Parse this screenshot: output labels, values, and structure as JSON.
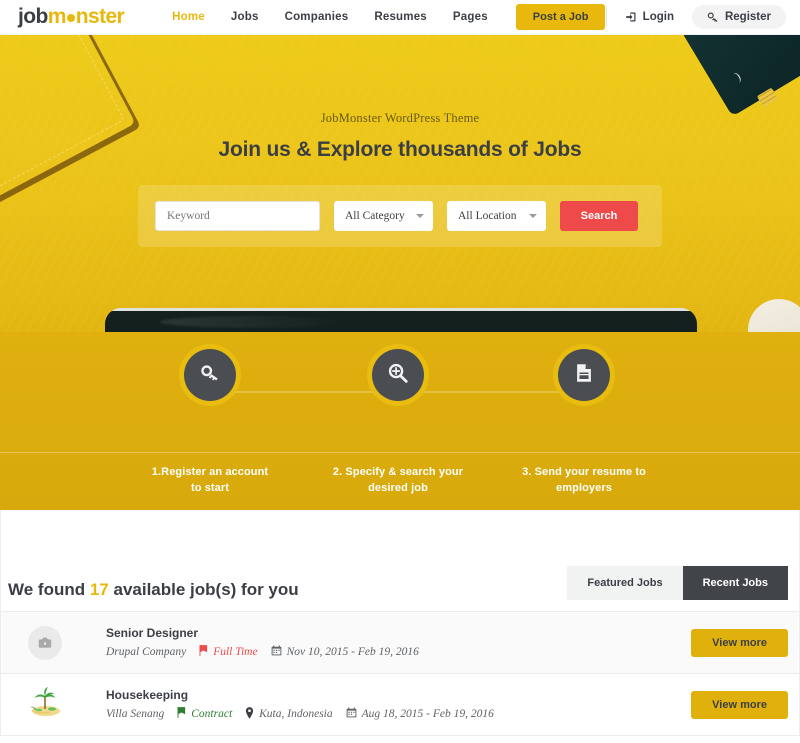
{
  "header": {
    "logo": {
      "part1": "job",
      "part2": "m",
      "part3": "nster"
    },
    "nav": [
      {
        "label": "Home",
        "active": true
      },
      {
        "label": "Jobs",
        "active": false
      },
      {
        "label": "Companies",
        "active": false
      },
      {
        "label": "Resumes",
        "active": false
      },
      {
        "label": "Pages",
        "active": false
      }
    ],
    "post_job_label": "Post a Job",
    "login_label": "Login",
    "login_icon": "sign-in-icon",
    "register_label": "Register",
    "register_icon": "key-icon"
  },
  "hero": {
    "subtitle": "JobMonster WordPress Theme",
    "title": "Join us & Explore thousands of Jobs",
    "search": {
      "keyword_placeholder": "Keyword",
      "category_value": "All Category",
      "location_value": "All Location",
      "button_label": "Search"
    },
    "colors": {
      "top": "#ecc61a",
      "bottom": "#e2b611",
      "search_button": "#ef4a4a"
    }
  },
  "steps": {
    "background": "#d8a90c",
    "items": [
      {
        "icon": "key-icon",
        "label": "1.Register an account\nto start"
      },
      {
        "icon": "search-plus-icon",
        "label": "2. Specify & search your\ndesired job"
      },
      {
        "icon": "document-icon",
        "label": "3. Send your resume to\nemployers"
      }
    ]
  },
  "jobs": {
    "heading_prefix": "We found ",
    "heading_count": "17",
    "heading_suffix": " available job(s) for you",
    "tabs": [
      {
        "label": "Featured Jobs",
        "active": false
      },
      {
        "label": "Recent Jobs",
        "active": true
      }
    ],
    "view_more_label": "View more",
    "list": [
      {
        "thumb_icon": "briefcase-icon",
        "title": "Senior Designer",
        "company": "Drupal Company",
        "type": "Full Time",
        "type_color": "#ef4a4a",
        "location": "",
        "dates": "Nov 10, 2015 - Feb 19, 2016",
        "view_more_label": "View more"
      },
      {
        "thumb_icon": "island-icon",
        "title": "Housekeeping",
        "company": "Villa Senang",
        "type": "Contract",
        "type_color": "#2e7d32",
        "location": "Kuta, Indonesia",
        "dates": "Aug 18, 2015 - Feb 19, 2016",
        "view_more_label": "View more"
      }
    ]
  }
}
